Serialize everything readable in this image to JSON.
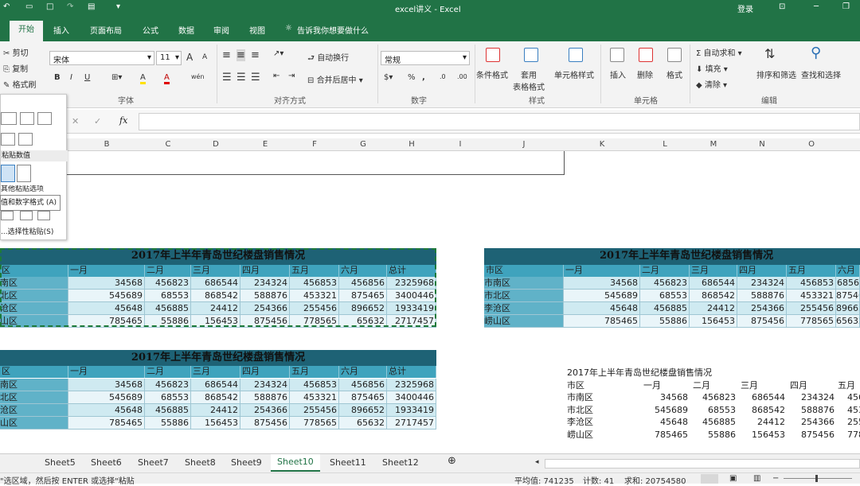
{
  "title_bar": {
    "title": "excel讲义 - Excel",
    "login": "登录"
  },
  "tabs": {
    "items": [
      "插入",
      "页面布局",
      "公式",
      "数据",
      "审阅",
      "视图"
    ],
    "active": "开始",
    "tell_me": "告诉我你想要做什么"
  },
  "ribbon": {
    "clipboard": {
      "cut": "剪切",
      "copy": "复制",
      "format_painter": "格式刷"
    },
    "font": {
      "name": "宋体",
      "size": "11",
      "group": "字体",
      "bold": "B",
      "italic": "I",
      "underline": "U",
      "grow": "A",
      "shrink": "A",
      "color_a": "A",
      "fill_a": "A",
      "pinyin": "wén"
    },
    "alignment": {
      "wrap": "自动换行",
      "merge": "合并后居中",
      "group": "对齐方式"
    },
    "number": {
      "format": "常规",
      "group": "数字",
      "percent": "%",
      "comma": ","
    },
    "styles": {
      "cond": "条件格式",
      "table": "套用\n表格格式",
      "cell": "单元格样式",
      "group": "样式"
    },
    "cells": {
      "insert": "插入",
      "delete": "删除",
      "format": "格式",
      "group": "单元格"
    },
    "editing": {
      "autosum": "自动求和",
      "fill": "填充",
      "clear": "清除",
      "sort": "排序和筛选",
      "find": "查找和选择",
      "group": "编辑"
    }
  },
  "formula_bar": {
    "fx": "fx",
    "cancel": "✕",
    "enter": "✓"
  },
  "paste_popup": {
    "section1": "粘贴数值",
    "section2": "其他粘贴选项",
    "tooltip": "值和数字格式 (A)",
    "special": "选择性粘贴(S)..."
  },
  "columns": [
    "B",
    "C",
    "D",
    "E",
    "F",
    "G",
    "H",
    "I",
    "J",
    "K",
    "L",
    "M",
    "N",
    "O"
  ],
  "table": {
    "title": "2017年上半年青岛世纪楼盘销售情况",
    "headers": [
      "市区",
      "一月",
      "二月",
      "三月",
      "四月",
      "五月",
      "六月",
      "总计"
    ],
    "rows": [
      [
        "市南区",
        "34568",
        "456823",
        "686544",
        "234324",
        "456853",
        "456856",
        "2325968"
      ],
      [
        "市北区",
        "545689",
        "68553",
        "868542",
        "588876",
        "453321",
        "875465",
        "3400446"
      ],
      [
        "李沧区",
        "45648",
        "456885",
        "24412",
        "254366",
        "255456",
        "896652",
        "1933419"
      ],
      [
        "崂山区",
        "785465",
        "55886",
        "156453",
        "875456",
        "778565",
        "65632",
        "2717457"
      ]
    ],
    "left_rows": [
      "南区",
      "北区",
      "沧区",
      "山区"
    ],
    "right_rows": [
      "市南区",
      "市北区",
      "李沧区",
      "崂山区"
    ],
    "left_first": "区"
  },
  "sheets": {
    "items": [
      "Sheet5",
      "Sheet6",
      "Sheet7",
      "Sheet8",
      "Sheet9",
      "Sheet10",
      "Sheet11",
      "Sheet12"
    ],
    "active": "Sheet10"
  },
  "status": {
    "hint": "选区域，然后按 ENTER 或选择\"粘贴\"",
    "avg": "平均值: 741235",
    "count": "计数: 41",
    "sum": "求和: 20754580"
  }
}
